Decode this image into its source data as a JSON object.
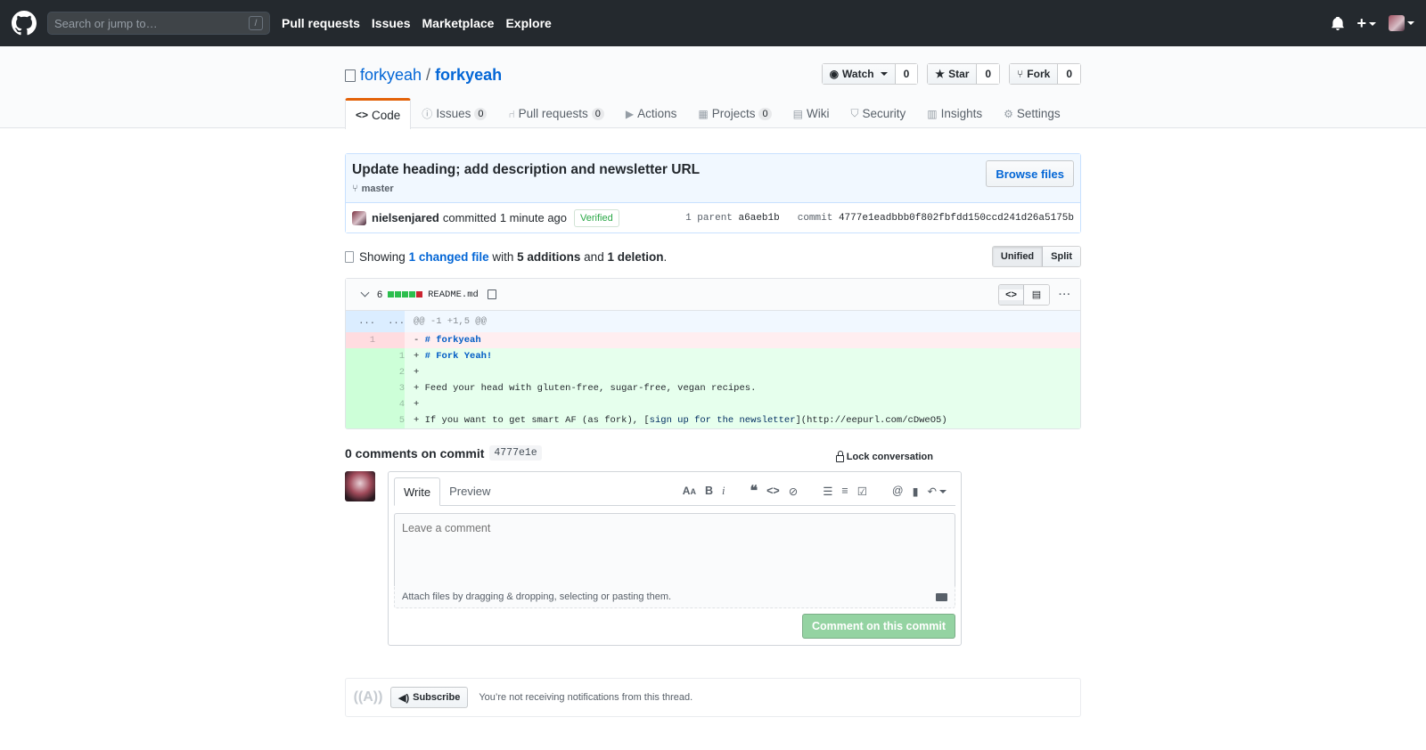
{
  "header": {
    "search_placeholder": "Search or jump to…",
    "search_shortcut": "/",
    "nav": [
      "Pull requests",
      "Issues",
      "Marketplace",
      "Explore"
    ]
  },
  "repo": {
    "owner": "forkyeah",
    "name": "forkyeah",
    "watch_label": "Watch",
    "watch_count": "0",
    "star_label": "Star",
    "star_count": "0",
    "fork_label": "Fork",
    "fork_count": "0"
  },
  "tabs": [
    {
      "label": "Code",
      "icon": "code-icon"
    },
    {
      "label": "Issues",
      "count": "0",
      "icon": "issue-icon"
    },
    {
      "label": "Pull requests",
      "count": "0",
      "icon": "pr-icon"
    },
    {
      "label": "Actions",
      "icon": "play-icon"
    },
    {
      "label": "Projects",
      "count": "0",
      "icon": "project-icon"
    },
    {
      "label": "Wiki",
      "icon": "book-icon"
    },
    {
      "label": "Security",
      "icon": "shield-icon"
    },
    {
      "label": "Insights",
      "icon": "graph-icon"
    },
    {
      "label": "Settings",
      "icon": "gear-icon"
    }
  ],
  "commit": {
    "title": "Update heading; add description and newsletter URL",
    "branch": "master",
    "browse_label": "Browse files",
    "author": "nielsenjared",
    "action": "committed",
    "time": "1 minute ago",
    "verified": "Verified",
    "parent_label": "1 parent",
    "parent_sha": "a6aeb1b",
    "commit_label": "commit",
    "sha": "4777e1eadbbb0f802fbfdd150ccd241d26a5175b"
  },
  "toc": {
    "showing": "Showing",
    "changed": "1 changed file",
    "with": "with",
    "additions": "5 additions",
    "and": "and",
    "deletions": "1 deletion",
    "period": ".",
    "unified": "Unified",
    "split": "Split"
  },
  "file": {
    "change_count": "6",
    "filename": "README.md",
    "diffstat": {
      "additions": 5,
      "deletions": 1,
      "blocks": 5
    },
    "hunk": {
      "left": "...",
      "right": "...",
      "text": "@@ -1 +1,5 @@"
    },
    "lines": [
      {
        "type": "del",
        "old": "1",
        "new": "",
        "sign": "-",
        "parts": [
          {
            "t": "# forkyeah",
            "c": "hd"
          }
        ]
      },
      {
        "type": "add",
        "old": "",
        "new": "1",
        "sign": "+",
        "parts": [
          {
            "t": "# Fork Yeah!",
            "c": "hd"
          }
        ]
      },
      {
        "type": "add",
        "old": "",
        "new": "2",
        "sign": "+",
        "parts": []
      },
      {
        "type": "add",
        "old": "",
        "new": "3",
        "sign": "+",
        "parts": [
          {
            "t": "Feed your head with gluten-free, sugar-free, vegan recipes.",
            "c": ""
          }
        ]
      },
      {
        "type": "add",
        "old": "",
        "new": "4",
        "sign": "+",
        "parts": []
      },
      {
        "type": "add",
        "old": "",
        "new": "5",
        "sign": "+",
        "parts": [
          {
            "t": "If you want to get smart AF (as fork), [",
            "c": ""
          },
          {
            "t": "sign up for the newsletter",
            "c": "lk"
          },
          {
            "t": "](http://eepurl.com/cDweO5)",
            "c": ""
          }
        ]
      }
    ]
  },
  "comments": {
    "count_label": "0 comments on commit",
    "short_sha": "4777e1e",
    "lock_label": "Lock conversation",
    "write_tab": "Write",
    "preview_tab": "Preview",
    "placeholder": "Leave a comment",
    "attach_text": "Attach files by dragging & dropping, selecting or pasting them.",
    "submit_label": "Comment on this commit"
  },
  "subscribe": {
    "button": "Subscribe",
    "text": "You’re not receiving notifications from this thread."
  }
}
